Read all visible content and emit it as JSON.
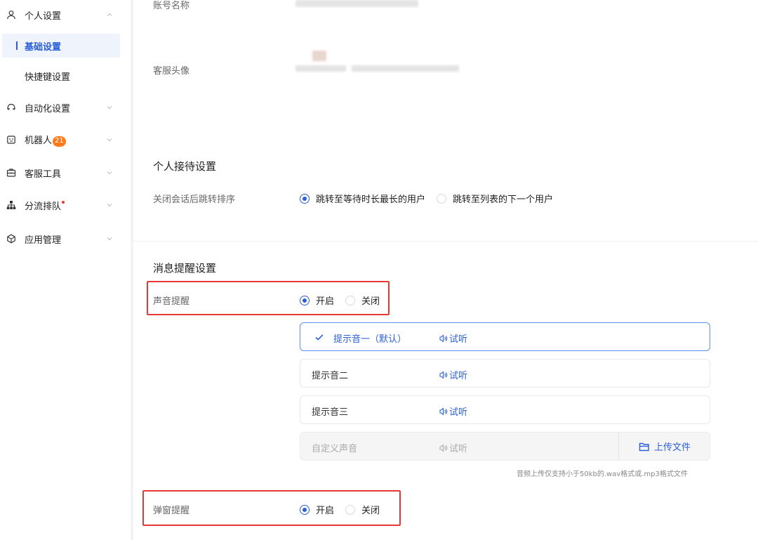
{
  "sidebar": {
    "items": [
      {
        "label": "个人设置",
        "icon": "user-icon",
        "expanded": true
      },
      {
        "label": "自动化设置",
        "icon": "automation-icon"
      },
      {
        "label": "机器人",
        "icon": "robot-icon",
        "badge": "21"
      },
      {
        "label": "客服工具",
        "icon": "toolbox-icon"
      },
      {
        "label": "分流排队",
        "icon": "org-chart-icon"
      },
      {
        "label": "应用管理",
        "icon": "cube-icon"
      }
    ],
    "sub_items": [
      {
        "label": "基础设置",
        "active": true
      },
      {
        "label": "快捷键设置"
      }
    ]
  },
  "account": {
    "name_label": "账号名称",
    "avatar_label": "客服头像"
  },
  "reception": {
    "title": "个人接待设置",
    "jump_label": "关闭会话后跳转排序",
    "options": [
      "跳转至等待时长最长的用户",
      "跳转至列表的下一个用户"
    ],
    "selected": 0
  },
  "notify": {
    "title": "消息提醒设置",
    "sound_label": "声音提醒",
    "sound_options": [
      "开启",
      "关闭"
    ],
    "sound_selected": 0,
    "sounds": [
      {
        "name": "提示音一（默认）",
        "selected": true
      },
      {
        "name": "提示音二"
      },
      {
        "name": "提示音三"
      },
      {
        "name": "自定义声音",
        "disabled": true
      }
    ],
    "listen_label": "试听",
    "upload_label": "上传文件",
    "hint": "音频上传仅支持小于50kb的.wav格式或.mp3格式文件",
    "popup_label": "弹窗提醒",
    "popup_options": [
      "开启",
      "关闭"
    ],
    "popup_selected": 0
  },
  "colors": {
    "accent": "#2a5fd8",
    "highlight_box": "#e53935",
    "badge": "#ff7a1a"
  }
}
